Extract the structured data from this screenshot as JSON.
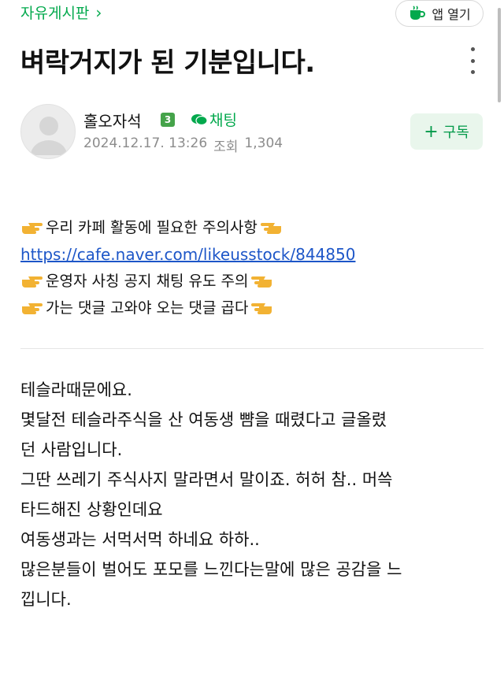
{
  "header": {
    "board_name": "자유게시판",
    "app_button_label": "앱 열기"
  },
  "post": {
    "title": "벼락거지가 된 기분입니다.",
    "author": "홀오자석",
    "author_level": "3",
    "chat_label": "채팅",
    "date": "2024.12.17. 13:26",
    "views_label": "조회",
    "views": "1,304",
    "subscribe_label": "구독"
  },
  "notice": {
    "line1": "우리 카페 활동에 필요한 주의사항",
    "link": "https://cafe.naver.com/likeusstock/844850",
    "line2": "운영자 사칭 공지 채팅 유도 주의",
    "line3": "가는 댓글 고와야 오는 댓글 곱다"
  },
  "body_lines": [
    "테슬라때문에요.",
    "몇달전 테슬라주식을 산 여동생 뺨을 때렸다고 글올렸",
    "던 사람입니다.",
    "그딴 쓰레기 주식사지 말라면서 말이죠. 허허 참.. 머쓱",
    "타드해진 상황인데요",
    "여동생과는 서먹서먹 하네요 하하..",
    "많은분들이 벌어도 포모를 느낀다는말에 많은 공감을 느",
    "낍니다."
  ],
  "colors": {
    "accent_green": "#03a94d",
    "link_blue": "#1d56c8",
    "subscribe_bg": "#e9f6ec"
  },
  "icons": {
    "cafe": "cup-icon",
    "more": "more-vertical-icon",
    "chat": "chat-bubble-icon",
    "hand_right": "pointing-right-hand-icon",
    "hand_left": "pointing-left-hand-icon"
  }
}
